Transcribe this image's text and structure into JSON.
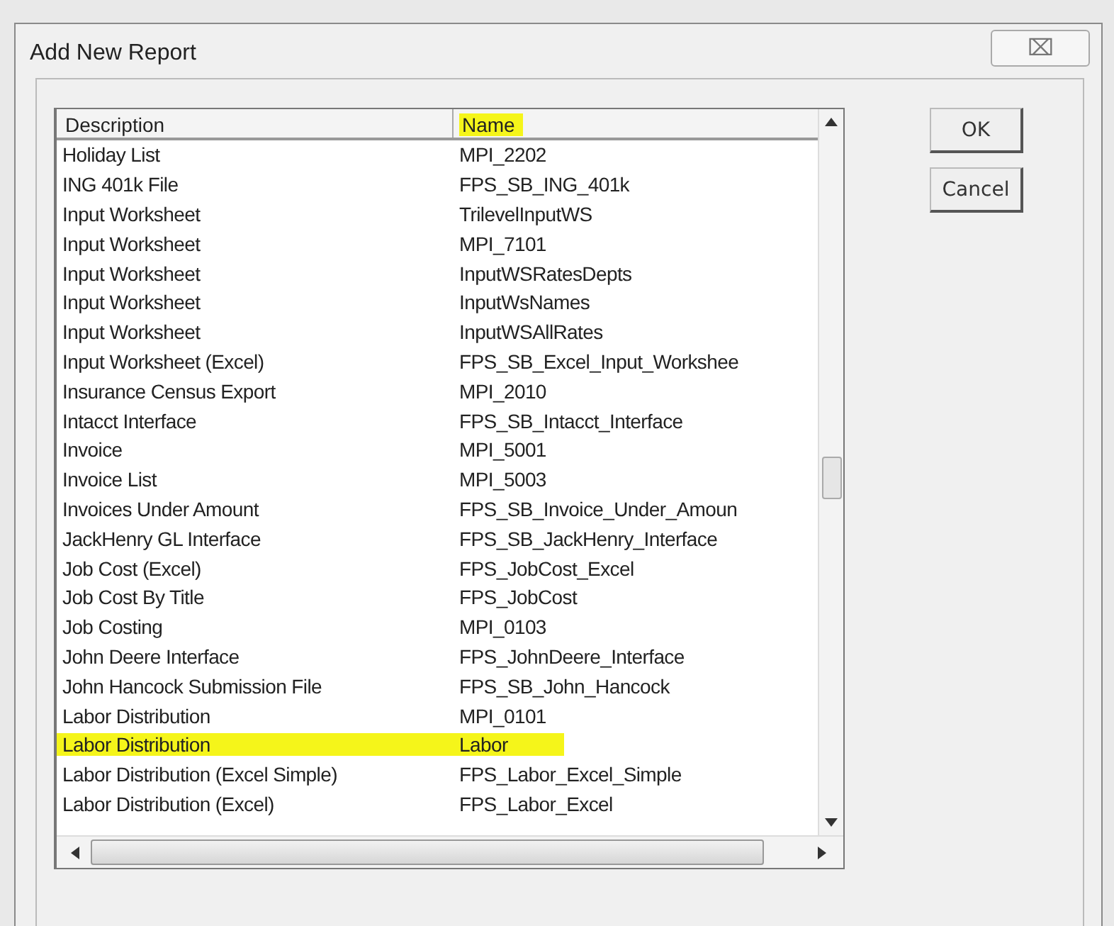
{
  "window": {
    "title": "Add New Report",
    "close": "⌧"
  },
  "list": {
    "columns": [
      {
        "label": "Description",
        "highlighted": false
      },
      {
        "label": "Name",
        "highlighted": true
      }
    ],
    "rows": [
      {
        "description": "Holiday List",
        "name": "MPI_2202",
        "highlighted": false
      },
      {
        "description": "ING 401k File",
        "name": "FPS_SB_ING_401k",
        "highlighted": false
      },
      {
        "description": "Input Worksheet",
        "name": "TrilevelInputWS",
        "highlighted": false
      },
      {
        "description": "Input Worksheet",
        "name": "MPI_7101",
        "highlighted": false
      },
      {
        "description": "Input Worksheet",
        "name": "InputWSRatesDepts",
        "highlighted": false
      },
      {
        "description": "Input Worksheet",
        "name": "InputWsNames",
        "highlighted": false
      },
      {
        "description": "Input Worksheet",
        "name": "InputWSAllRates",
        "highlighted": false
      },
      {
        "description": "Input Worksheet (Excel)",
        "name": "FPS_SB_Excel_Input_Workshee",
        "highlighted": false
      },
      {
        "description": "Insurance Census Export",
        "name": "MPI_2010",
        "highlighted": false
      },
      {
        "description": "Intacct Interface",
        "name": "FPS_SB_Intacct_Interface",
        "highlighted": false
      },
      {
        "description": "Invoice",
        "name": "MPI_5001",
        "highlighted": false
      },
      {
        "description": "Invoice List",
        "name": "MPI_5003",
        "highlighted": false
      },
      {
        "description": "Invoices Under Amount",
        "name": "FPS_SB_Invoice_Under_Amoun",
        "highlighted": false
      },
      {
        "description": "JackHenry GL Interface",
        "name": "FPS_SB_JackHenry_Interface",
        "highlighted": false
      },
      {
        "description": "Job Cost (Excel)",
        "name": "FPS_JobCost_Excel",
        "highlighted": false
      },
      {
        "description": "Job Cost By Title",
        "name": "FPS_JobCost",
        "highlighted": false
      },
      {
        "description": "Job Costing",
        "name": "MPI_0103",
        "highlighted": false
      },
      {
        "description": "John Deere Interface",
        "name": "FPS_JohnDeere_Interface",
        "highlighted": false
      },
      {
        "description": "John Hancock Submission File",
        "name": "FPS_SB_John_Hancock",
        "highlighted": false
      },
      {
        "description": "Labor Distribution",
        "name": "MPI_0101",
        "highlighted": false
      },
      {
        "description": "Labor Distribution",
        "name": "Labor",
        "highlighted": true
      },
      {
        "description": "Labor Distribution (Excel Simple)",
        "name": "FPS_Labor_Excel_Simple",
        "highlighted": false
      },
      {
        "description": "Labor Distribution (Excel)",
        "name": "FPS_Labor_Excel",
        "highlighted": false
      }
    ]
  },
  "buttons": [
    {
      "label": "OK"
    },
    {
      "label": "Cancel"
    }
  ]
}
